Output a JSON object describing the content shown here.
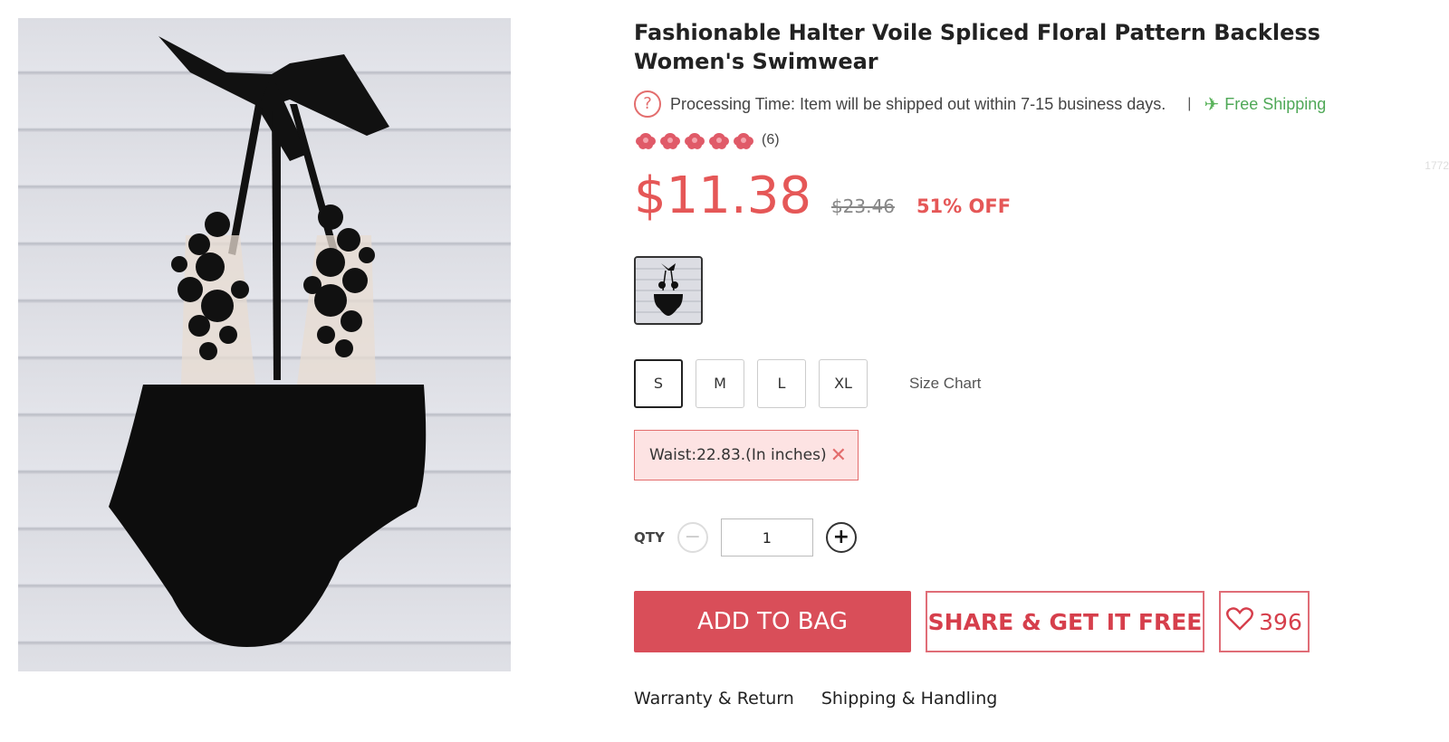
{
  "product": {
    "title": "Fashionable Halter Voile Spliced Floral Pattern Backless Women's Swimwear",
    "image_alt": "black halter swimsuit on white wood planks"
  },
  "shipping": {
    "processing_icon": "question-icon",
    "processing_glyph": "?",
    "processing_text": "Processing Time: Item will be shipped out within 7-15 business days.",
    "separator": "|",
    "free_shipping_icon": "plane-icon",
    "free_shipping_glyph": "✈",
    "free_shipping_text": "Free Shipping"
  },
  "rating": {
    "stars": 5,
    "star_icon": "rose-icon",
    "review_count": "(6)",
    "ghost_number": "1772"
  },
  "pricing": {
    "price": "$11.38",
    "original_price": "$23.46",
    "discount": "51% OFF",
    "accent_color": "#e55757"
  },
  "sizes": {
    "options": [
      "S",
      "M",
      "L",
      "XL"
    ],
    "selected": "S",
    "size_chart_label": "Size Chart",
    "note": "Waist:22.83.(In inches)",
    "note_close_glyph": "✕"
  },
  "quantity": {
    "label": "QTY",
    "value": "1",
    "minus_glyph": "−",
    "plus_glyph": "+"
  },
  "actions": {
    "add_to_bag": "ADD TO BAG",
    "share": "SHARE & GET IT FREE",
    "favorites_count": "396",
    "button_color": "#d94e59"
  },
  "tabs": [
    "Warranty & Return",
    "Shipping & Handling"
  ]
}
